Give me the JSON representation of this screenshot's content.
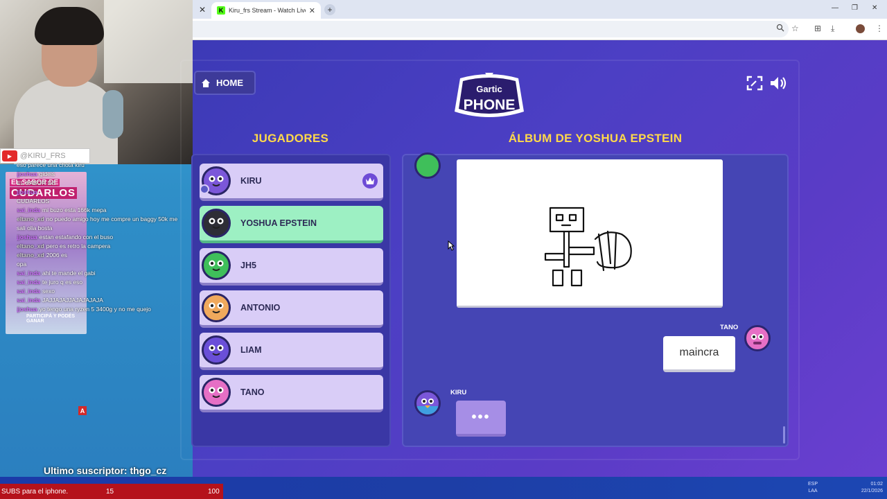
{
  "stream": {
    "handle": "@KIRU_FRS",
    "promo_line1": "EL SABOR DE",
    "promo_line2": "CUDARLOS",
    "promo_footer": "PARTICIPÁ Y PODÉS GANAR",
    "last_subscriber": "Ultimo suscriptor: thgo_cz",
    "badge": "A",
    "chat": [
      {
        "user": "",
        "text": "eso parece una chota kiru",
        "color": "gray"
      },
      {
        "user": "jjoshua",
        "text": "gideis",
        "color": "purple"
      },
      {
        "user": "",
        "text": "EL SABOR DE",
        "color": "gray"
      },
      {
        "user": "jjoshua",
        "text": "",
        "color": "purple"
      },
      {
        "user": "",
        "text": "CUDARLOS",
        "color": "gray"
      },
      {
        "user": "sai_inda",
        "text": "mi buzo esta 166k mepa",
        "color": "purple"
      },
      {
        "user": "eltano_xd",
        "text": "no puedo amigo hoy me compre un baggy 50k me",
        "color": "gray"
      },
      {
        "user": "",
        "text": "sali olia bosta",
        "color": "gray"
      },
      {
        "user": "jjoshua",
        "text": "estan estafando con el buso",
        "color": "purple"
      },
      {
        "user": "eltano_xd",
        "text": "pero es retro la campera",
        "color": "gray"
      },
      {
        "user": "eltano_xd",
        "text": "2006 es",
        "color": "gray"
      },
      {
        "user": "",
        "text": "opa",
        "color": "gray"
      },
      {
        "user": "sai_inda",
        "text": "ahi te mande el gabi",
        "color": "purple"
      },
      {
        "user": "sai_inda",
        "text": "te juro q es eso",
        "color": "purple"
      },
      {
        "user": "sai_inda",
        "text": "sexo",
        "color": "purple"
      },
      {
        "user": "",
        "text": "",
        "color": "gray"
      },
      {
        "user": "sai_inda",
        "text": "JAJJAJAJJAJAJAJAJA",
        "color": "purple"
      },
      {
        "user": "jjoshua",
        "text": "yo tengo una ryzen 5 3400g y no me quejo",
        "color": "purple"
      }
    ],
    "ticker": {
      "message": "SUBS para el iphone.",
      "count": "15",
      "goal": "100"
    }
  },
  "browser": {
    "tab_title": "Kiru_frs Stream - Watch Live on",
    "tab_favicon": "K",
    "new_tab": "+"
  },
  "game": {
    "home_label": "HOME",
    "logo_top": "Gartic",
    "logo_bottom": "PHONE",
    "players_heading": "JUGADORES",
    "album_heading": "ÁLBUM DE YOSHUA EPSTEIN",
    "players": [
      {
        "name": "KIRU",
        "color": "#7b57d9",
        "host": true,
        "active": false
      },
      {
        "name": "YOSHUA EPSTEIN",
        "color": "#2e2e36",
        "host": false,
        "active": true
      },
      {
        "name": "JH5",
        "color": "#3fbf5a",
        "host": false,
        "active": false
      },
      {
        "name": "ANTONIO",
        "color": "#f0a95c",
        "host": false,
        "active": false
      },
      {
        "name": "LIAM",
        "color": "#6a4fd8",
        "host": false,
        "active": false
      },
      {
        "name": "TANO",
        "color": "#e66fc5",
        "host": false,
        "active": false
      }
    ],
    "album": {
      "guess_author": "TANO",
      "guess_text": "maincra",
      "typing_author": "KIRU",
      "typing_text": "•••"
    }
  },
  "system": {
    "lang_top": "ESP",
    "lang_bottom": "LAA",
    "time": "01:02",
    "date": "22/1/2026"
  },
  "icons": [
    "home-icon",
    "fullscreen-icon",
    "volume-icon",
    "crown-icon",
    "zoom-icon",
    "star-icon",
    "translate-icon",
    "download-icon",
    "profile-icon",
    "more-icon",
    "cursor-icon"
  ]
}
